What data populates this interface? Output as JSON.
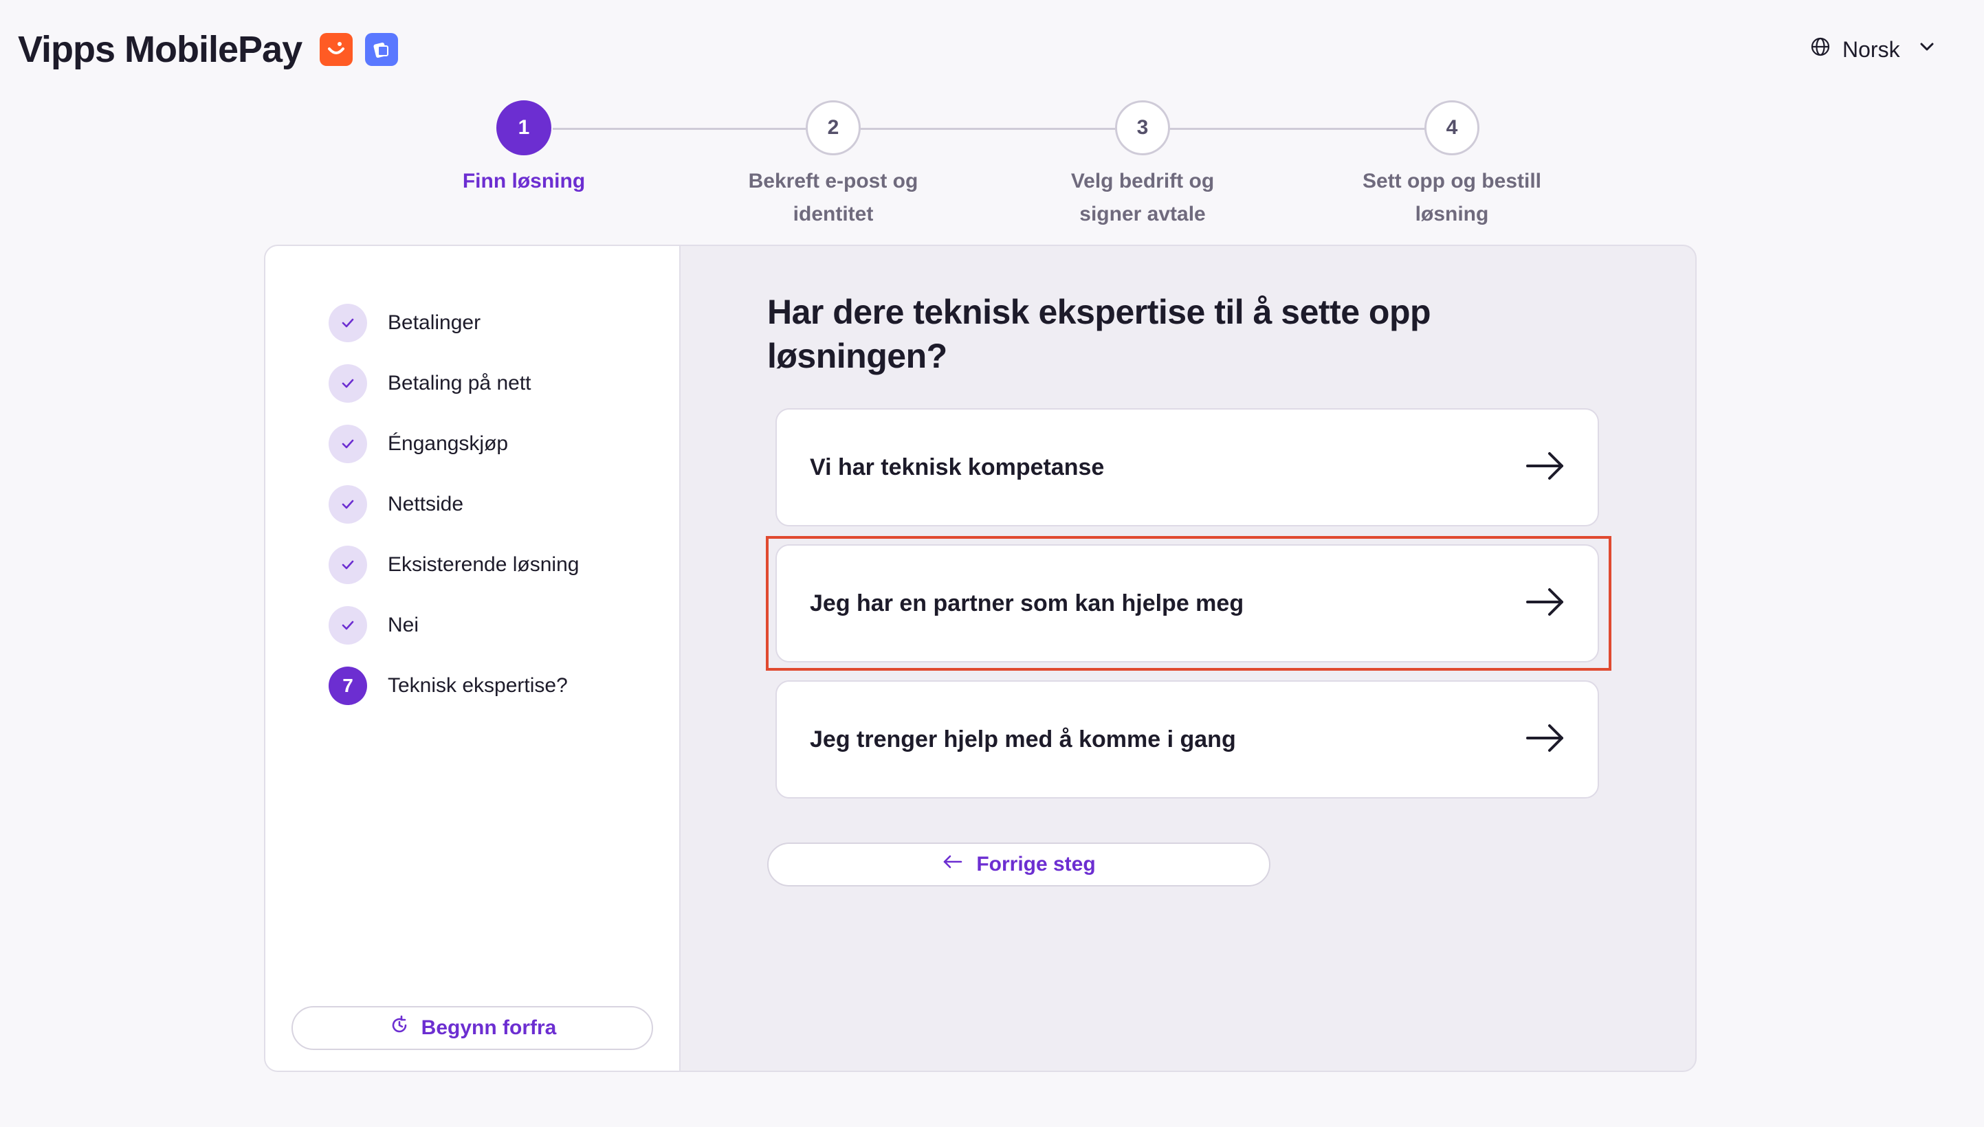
{
  "header": {
    "brand": "Vipps MobilePay",
    "language": "Norsk"
  },
  "stepper": {
    "current": 1,
    "steps": [
      {
        "number": "1",
        "label": "Finn løsning"
      },
      {
        "number": "2",
        "label": "Bekreft e-post og identitet"
      },
      {
        "number": "3",
        "label": "Velg bedrift og signer avtale"
      },
      {
        "number": "4",
        "label": "Sett opp og bestill løsning"
      }
    ]
  },
  "sidebar": {
    "items": [
      {
        "label": "Betalinger",
        "status": "done"
      },
      {
        "label": "Betaling på nett",
        "status": "done"
      },
      {
        "label": "Éngangskjøp",
        "status": "done"
      },
      {
        "label": "Nettside",
        "status": "done"
      },
      {
        "label": "Eksisterende løsning",
        "status": "done"
      },
      {
        "label": "Nei",
        "status": "done"
      },
      {
        "label": "Teknisk ekspertise?",
        "status": "current",
        "number": "7"
      }
    ],
    "restart_label": "Begynn forfra"
  },
  "main": {
    "question": "Har dere teknisk ekspertise til å sette opp løsningen?",
    "options": [
      {
        "label": "Vi har teknisk kompetanse"
      },
      {
        "label": "Jeg har en partner som kan hjelpe meg"
      },
      {
        "label": "Jeg trenger hjelp med å komme i gang"
      }
    ],
    "back_label": "Forrige steg"
  },
  "colors": {
    "accent": "#6c2ed1",
    "brand_orange": "#ff5b24",
    "brand_blue": "#5a78ff",
    "highlight": "#e04a30"
  }
}
